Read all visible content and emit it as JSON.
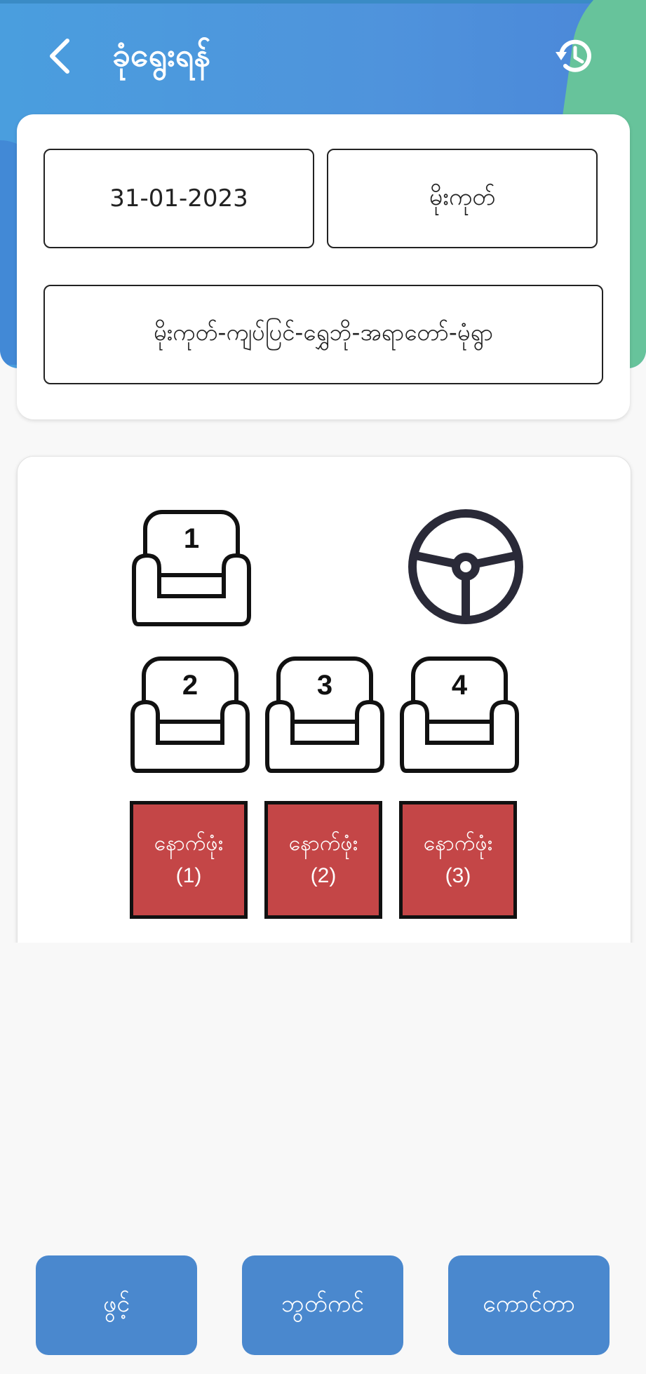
{
  "header": {
    "title": "ခုံရွေးရန်",
    "back_icon": "chevron-left-icon",
    "history_icon": "history-icon"
  },
  "form": {
    "date": "31-01-2023",
    "town": "မိုးကုတ်",
    "route": "မိုးကုတ်-ကျပ်ပြင်-ရွှေဘို-အရာတော်-မုံရွာ"
  },
  "seats": {
    "seat1": "1",
    "seat2": "2",
    "seat3": "3",
    "seat4": "4",
    "steering_icon": "steering-wheel-icon"
  },
  "back_seats": [
    {
      "label": "နောက်ဖုံး",
      "number": "(1)"
    },
    {
      "label": "နောက်ဖုံး",
      "number": "(2)"
    },
    {
      "label": "နောက်ဖုံး",
      "number": "(3)"
    }
  ],
  "actions": {
    "open": "ဖွင့်",
    "book": "ဘွတ်ကင်",
    "counter": "ကောင်တာ"
  },
  "colors": {
    "header_blue": "#4a9ede",
    "header_green": "#67c39b",
    "booked_red": "#c44647",
    "button_blue": "#4a88ce"
  }
}
